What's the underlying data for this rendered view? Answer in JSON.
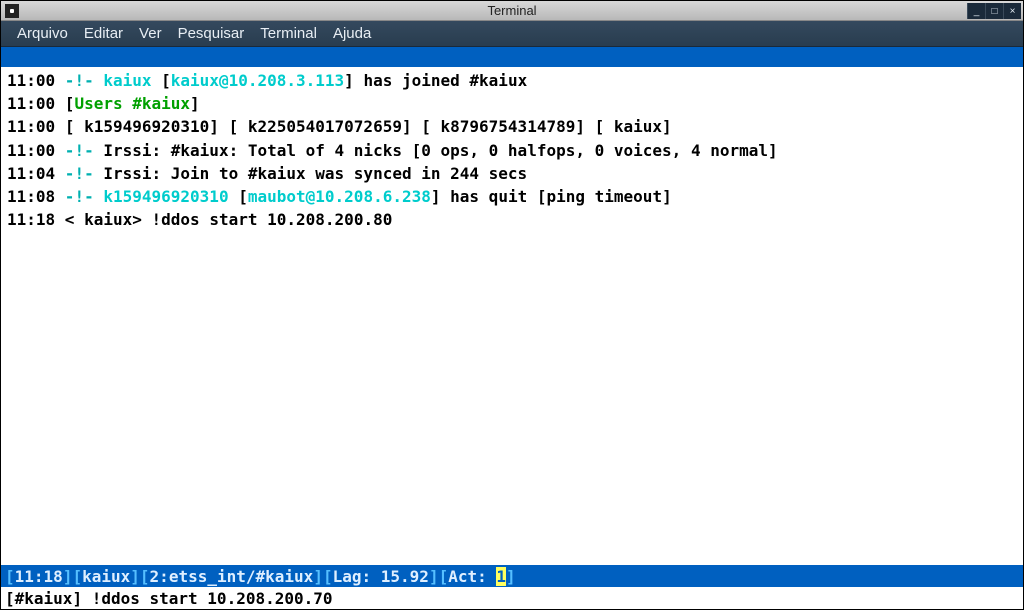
{
  "window": {
    "title": "Terminal",
    "controls": {
      "min": "_",
      "max": "□",
      "close": "×"
    }
  },
  "menubar": {
    "items": [
      "Arquivo",
      "Editar",
      "Ver",
      "Pesquisar",
      "Terminal",
      "Ajuda"
    ]
  },
  "chat": {
    "lines": [
      {
        "time": "11:00",
        "marker": " -!- ",
        "nick": "kaiux",
        "host": "kaiux@10.208.3.113",
        "rest": " has joined #kaiux"
      },
      {
        "time": "11:00",
        "users_header": "Users #kaiux"
      },
      {
        "time": "11:00",
        "users_list": "[ k159496920310] [ k225054017072659] [ k8796754314789] [ kaiux]"
      },
      {
        "time": "11:00",
        "marker": " -!- ",
        "plain": "Irssi: #kaiux: Total of 4 nicks [0 ops, 0 halfops, 0 voices, 4 normal]"
      },
      {
        "time": "11:04",
        "marker": " -!- ",
        "plain": "Irssi: Join to #kaiux was synced in 244 secs"
      },
      {
        "time": "11:08",
        "marker": " -!- ",
        "nick": "k159496920310",
        "host": "maubot@10.208.6.238",
        "rest": " has quit [ping timeout]"
      },
      {
        "time": "11:18",
        "msg_nick": "kaiux",
        "msg_text": " !ddos start 10.208.200.80"
      }
    ]
  },
  "status": {
    "time": "11:18",
    "nick": "kaiux",
    "window": "2:etss_int/#kaiux",
    "lag_label": "Lag: ",
    "lag_value": "15.92",
    "act_label": "Act: ",
    "act_value": "1"
  },
  "input": {
    "channel": "#kaiux",
    "text": "!ddos start 10.208.200.70"
  }
}
